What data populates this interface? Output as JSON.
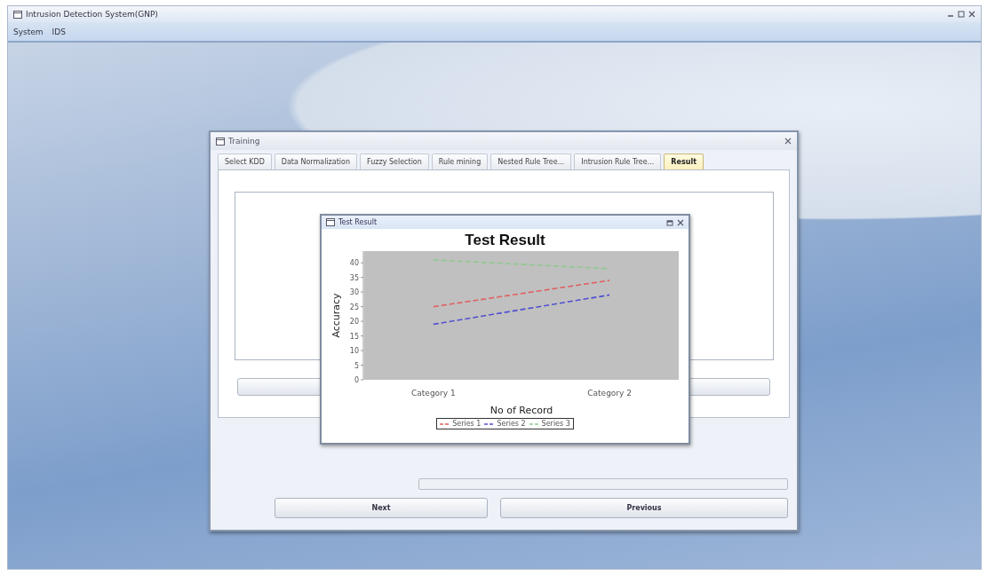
{
  "window": {
    "title": "Intrusion Detection System(GNP)"
  },
  "menu": [
    {
      "label": "System"
    },
    {
      "label": "IDS"
    }
  ],
  "dialog": {
    "title": "Training",
    "tabs": [
      {
        "label": "Select KDD",
        "selected": false
      },
      {
        "label": "Data Normalization",
        "selected": false
      },
      {
        "label": "Fuzzy Selection",
        "selected": false
      },
      {
        "label": "Rule mining",
        "selected": false
      },
      {
        "label": "Nested Rule Tree...",
        "selected": false
      },
      {
        "label": "Intrusion Rule Tree...",
        "selected": false
      },
      {
        "label": "Result",
        "selected": true
      }
    ],
    "buttons": [
      {
        "label": "Next"
      },
      {
        "label": "Previous"
      }
    ]
  },
  "result_window": {
    "title": "Test Result",
    "chart_data": {
      "type": "line",
      "title": "Test Result",
      "xlabel": "No of Record",
      "ylabel": "Accuracy",
      "categories": [
        "Category 1",
        "Category 2"
      ],
      "series": [
        {
          "name": "Series 1",
          "color": "#e06060",
          "line_style": "dashed",
          "values": [
            25,
            34
          ]
        },
        {
          "name": "Series 2",
          "color": "#5050d0",
          "line_style": "dashed",
          "values": [
            19,
            29
          ]
        },
        {
          "name": "Series 3",
          "color": "#90c890",
          "line_style": "dashed",
          "values": [
            41,
            38
          ]
        }
      ],
      "ylim": [
        0,
        44
      ],
      "yticks": [
        0,
        5,
        10,
        15,
        20,
        25,
        30,
        35,
        40
      ]
    }
  }
}
